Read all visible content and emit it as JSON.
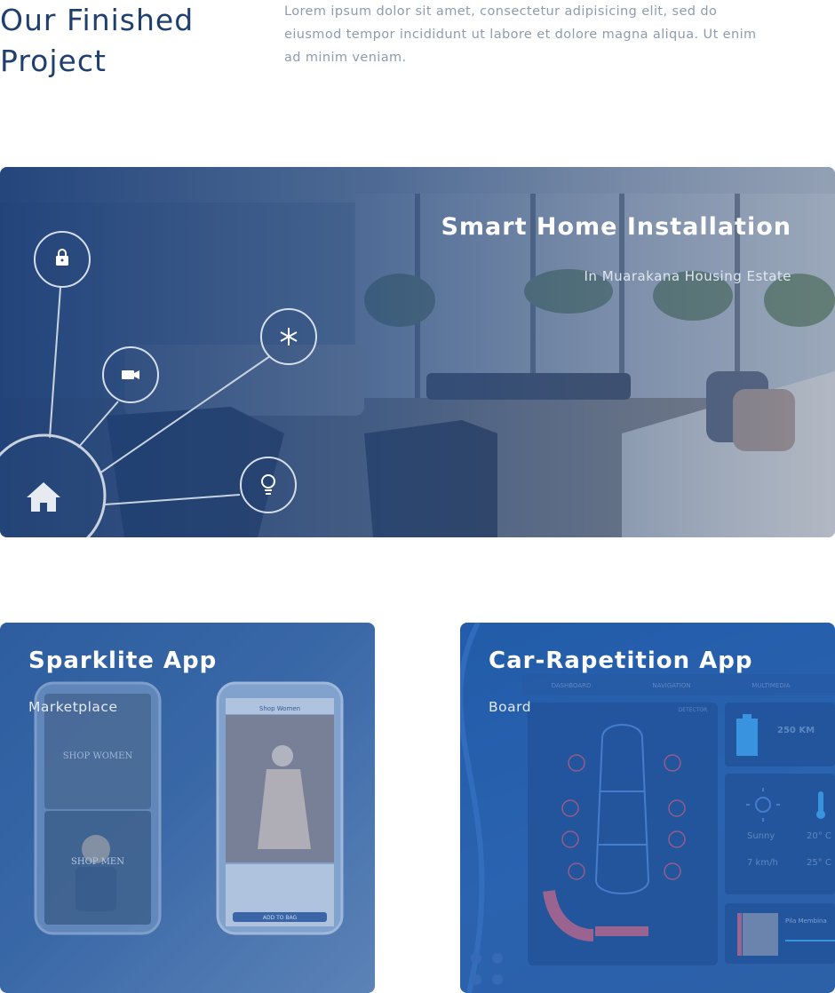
{
  "intro": {
    "title": "Our Finished Project",
    "description": "Lorem ipsum dolor sit amet, consectetur adipisicing elit, sed do eiusmod tempor incididunt ut labore et dolore magna aliqua. Ut enim ad minim veniam."
  },
  "featured": {
    "title": "Smart Home Installation",
    "subtitle": "In Muarakana Housing Estate",
    "icons": [
      "lock-icon",
      "video-camera-icon",
      "snowflake-icon",
      "lightbulb-icon",
      "home-icon"
    ]
  },
  "projects": [
    {
      "title": "Sparklite App",
      "subtitle": "Marketplace",
      "mockup_text": {
        "shop_women": "SHOP WOMEN",
        "shop_men": "SHOP MEN",
        "screen_title": "Shop Women",
        "add_to_bag": "ADD TO BAG"
      }
    },
    {
      "title": "Car-Rapetition App",
      "subtitle": "Board",
      "dashboard_text": {
        "tabs": [
          "DASHBOARD",
          "NAVIGATION",
          "MULTIMEDIA"
        ],
        "detector": "DETECTOR",
        "range": "250 KM",
        "weather": "Sunny",
        "wind": "7 km/h",
        "temp_out": "20° C",
        "temp_in": "25° C",
        "music": "Pila Membina"
      }
    }
  ],
  "colors": {
    "heading": "#1f3f6e",
    "body_text": "#8e9cae",
    "overlay_blue": "#1e4a86"
  }
}
